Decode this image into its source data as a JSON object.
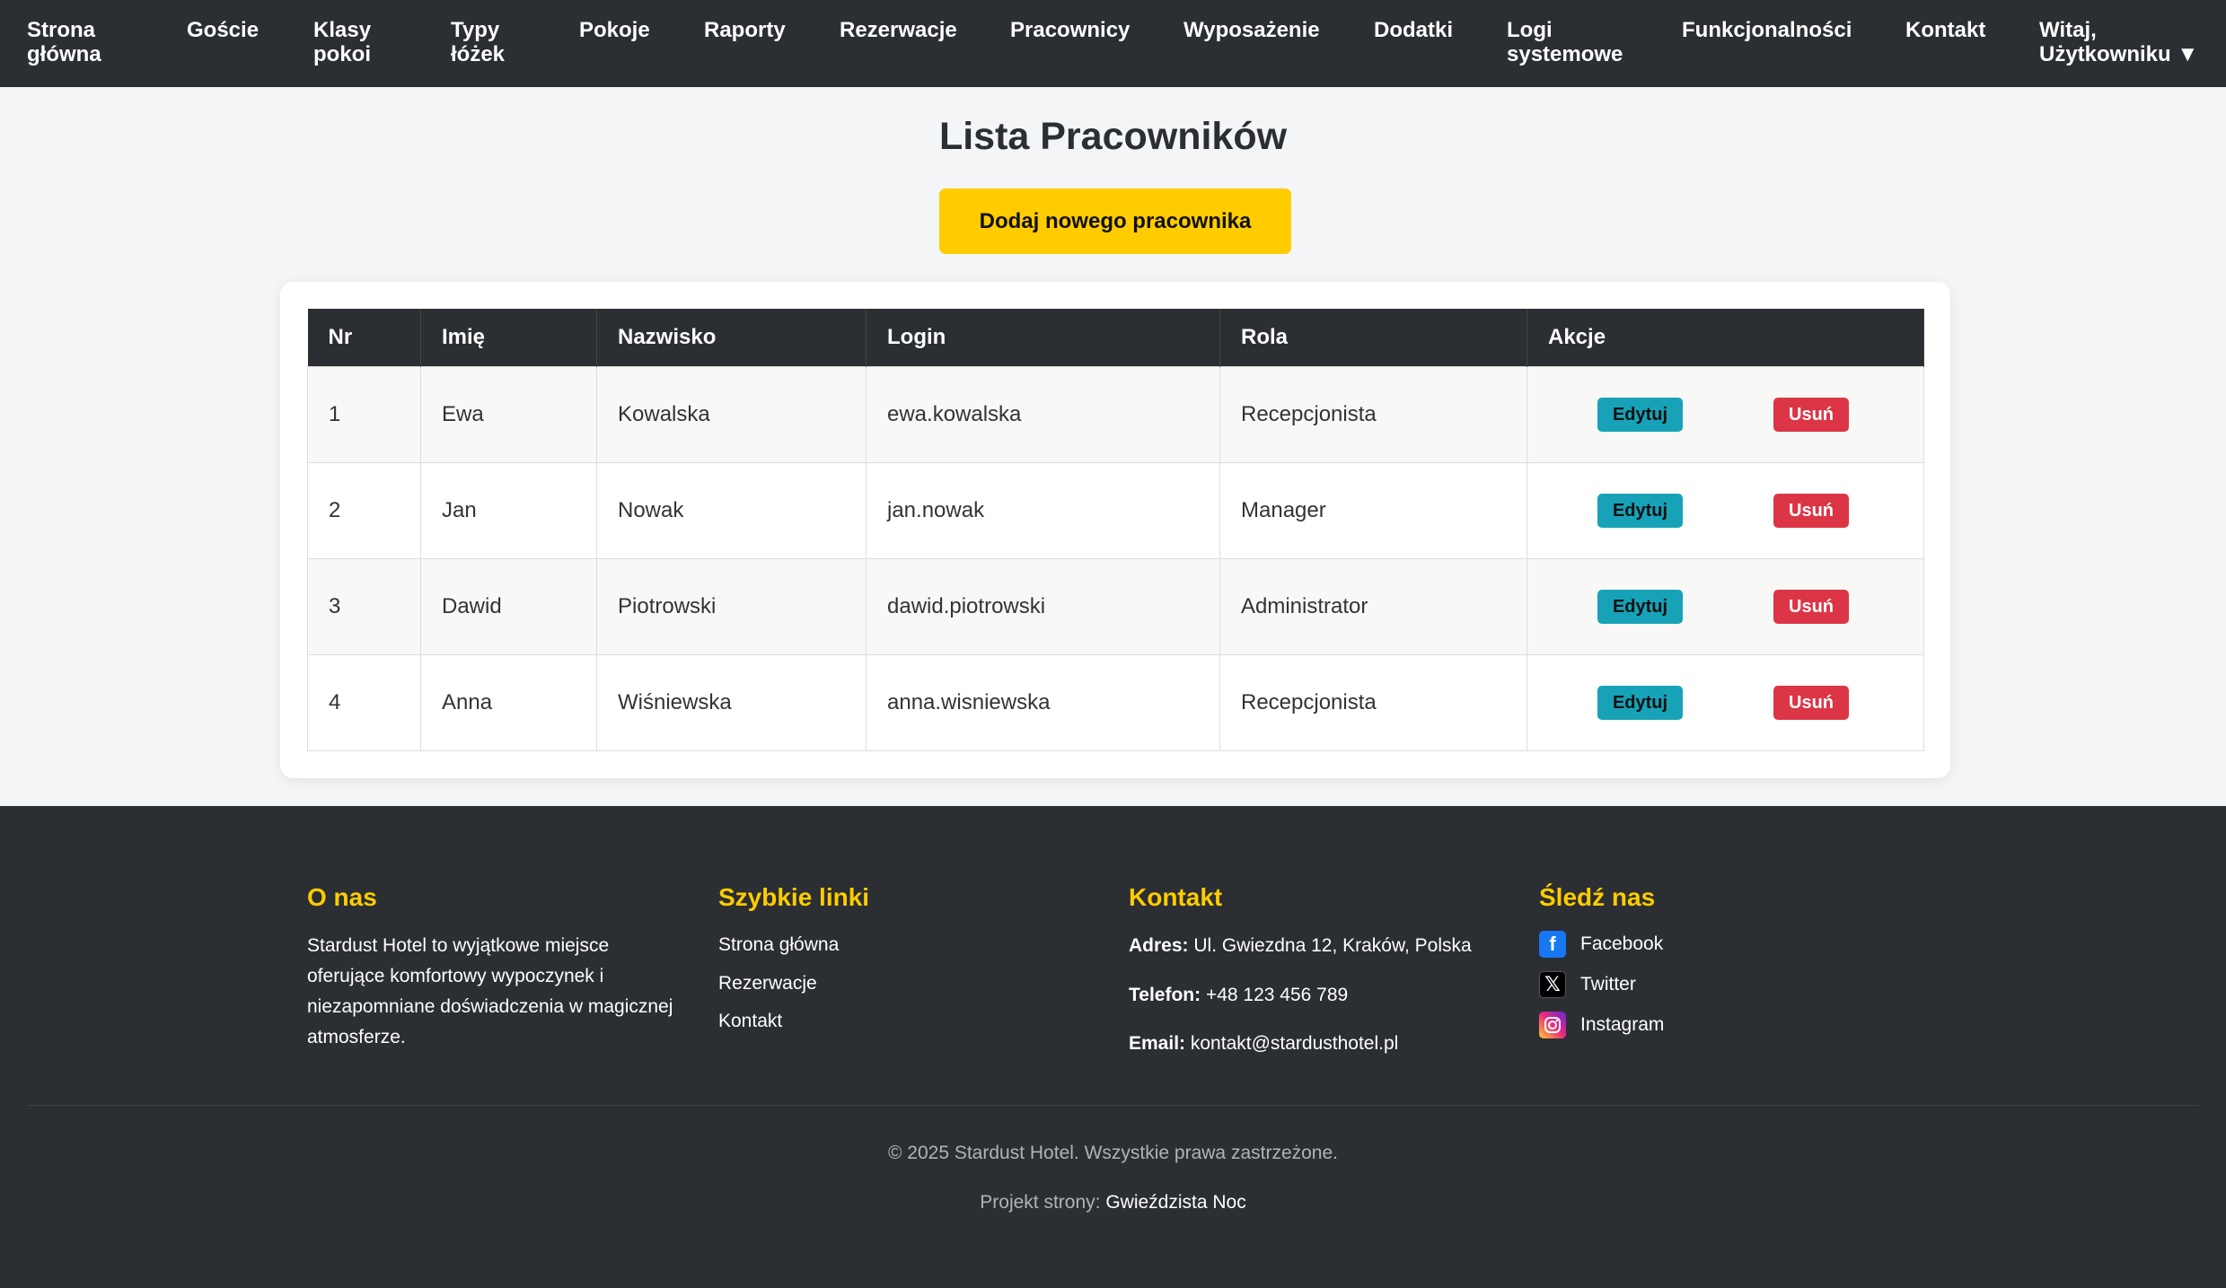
{
  "nav": {
    "home": "Strona główna",
    "guests": "Goście",
    "room_classes": "Klasy pokoi",
    "bed_types": "Typy łóżek",
    "rooms": "Pokoje",
    "reports": "Raporty",
    "reservations": "Rezerwacje",
    "employees": "Pracownicy",
    "equipment": "Wyposażenie",
    "addons": "Dodatki",
    "system_logs": "Logi systemowe",
    "features": "Funkcjonalności",
    "contact": "Kontakt",
    "user_menu": "Witaj, Użytkowniku ▼"
  },
  "main": {
    "title": "Lista Pracowników",
    "add_button": "Dodaj nowego pracownika"
  },
  "table": {
    "headers": [
      "Nr",
      "Imię",
      "Nazwisko",
      "Login",
      "Rola",
      "Akcje"
    ],
    "edit_label": "Edytuj",
    "delete_label": "Usuń",
    "rows": [
      {
        "nr": "1",
        "first": "Ewa",
        "last": "Kowalska",
        "login": "ewa.kowalska",
        "role": "Recepcjonista"
      },
      {
        "nr": "2",
        "first": "Jan",
        "last": "Nowak",
        "login": "jan.nowak",
        "role": "Manager"
      },
      {
        "nr": "3",
        "first": "Dawid",
        "last": "Piotrowski",
        "login": "dawid.piotrowski",
        "role": "Administrator"
      },
      {
        "nr": "4",
        "first": "Anna",
        "last": "Wiśniewska",
        "login": "anna.wisniewska",
        "role": "Recepcjonista"
      }
    ]
  },
  "footer": {
    "about": {
      "heading": "O nas",
      "text": "Stardust Hotel to wyjątkowe miejsce oferujące komfortowy wypoczynek i niezapomniane doświadczenia w magicznej atmosferze."
    },
    "quick_links": {
      "heading": "Szybkie linki",
      "links": [
        "Strona główna",
        "Rezerwacje",
        "Kontakt"
      ]
    },
    "contact": {
      "heading": "Kontakt",
      "address_label": "Adres:",
      "address": "Ul. Gwiezdna 12, Kraków, Polska",
      "phone_label": "Telefon:",
      "phone": "+48 123 456 789",
      "email_label": "Email:",
      "email": "kontakt@stardusthotel.pl"
    },
    "social": {
      "heading": "Śledź nas",
      "items": [
        {
          "label": "Facebook",
          "icon": "facebook-icon"
        },
        {
          "label": "Twitter",
          "icon": "x-twitter-icon"
        },
        {
          "label": "Instagram",
          "icon": "instagram-icon"
        }
      ]
    },
    "copyright": "© 2025 Stardust Hotel. Wszystkie prawa zastrzeżone.",
    "credit_prefix": "Projekt strony:",
    "credit_name": "Gwieździsta Noc"
  },
  "colors": {
    "nav_bg": "#2b2e33",
    "accent": "#ffcc00",
    "edit": "#17a2b8",
    "delete": "#dc3545"
  }
}
